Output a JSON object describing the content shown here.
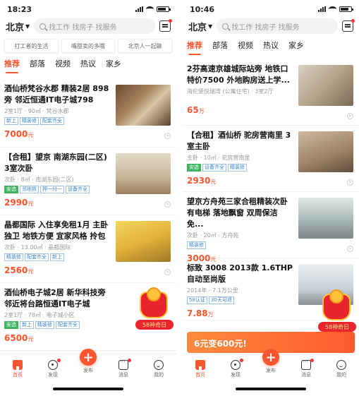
{
  "left": {
    "status": {
      "time": "18:23"
    },
    "header": {
      "city": "北京",
      "search_placeholder": "找工作 找房子 找服务"
    },
    "chips": [
      "打工者的生活",
      "嘴甜卖的多哦",
      "北京人一起聊"
    ],
    "tabs": [
      "推荐",
      "部落",
      "视频",
      "热议",
      "家乡"
    ],
    "listings": [
      {
        "title": "酒仙桥梵谷水郡 精装2居 898旁 邻近恒通IT电子城798",
        "meta": "2室1厅 · 90㎡ · 梵谷水郡",
        "tags": [
          "新上",
          "精装修",
          "配套齐全"
        ],
        "price": "7000",
        "unit": "元"
      },
      {
        "title": "【合租】望京 南湖东园(二区) 3室次卧",
        "meta": "次卧 · 8㎡ · 南湖东园(二区)",
        "tags": [
          "安选",
          "邻地铁",
          "押一付一",
          "设备齐全"
        ],
        "price": "2990",
        "unit": "元"
      },
      {
        "title": "晶都国际 入住享免租1月 主卧独卫 地铁方便 宜家风格 拎包",
        "meta": "次卧 · 13.00㎡ · 晶都国际",
        "tags": [
          "精装修",
          "配套齐全",
          "新上"
        ],
        "price": "2560",
        "unit": "元"
      },
      {
        "title": "酒仙桥电子城2居 新华科技旁 邻近将台路恒通IT电子城",
        "meta": "2室1厅 · 78㎡ · 电子城小区",
        "tags": [
          "安选",
          "新上",
          "精装修",
          "配套齐全"
        ],
        "price": "6500",
        "unit": "元"
      }
    ],
    "redpack": "58神奇日"
  },
  "right": {
    "status": {
      "time": "10:46"
    },
    "header": {
      "city": "北京",
      "search_placeholder": "找工作 找房子 找服务"
    },
    "tabs": [
      "推荐",
      "部落",
      "视频",
      "热议",
      "家乡"
    ],
    "listings": [
      {
        "title": "2芬高速京雄城际站旁 地铁口特价7500 外地购房送上学...",
        "meta": "海伦堡悦瑞湾 (公寓住宅) · 3室2厅",
        "tags": [],
        "price": "65",
        "unit": "万"
      },
      {
        "title": "【合租】酒仙桥 驼房营南里 3室主卧",
        "meta": "主卧 · 10㎡ · 驼房营南里",
        "tags": [
          "安选",
          "设备齐全",
          "精装修"
        ],
        "price": "2930",
        "unit": "元"
      },
      {
        "title": "望京方舟苑三家合租精装次卧有电梯 落地飘窗 双周保洁免...",
        "meta": "次卧 · 20㎡ · 方舟苑",
        "tags": [
          "精装修"
        ],
        "price": "3000",
        "unit": "元"
      },
      {
        "title": "标致 3008 2013款 1.6THP 自动至尚版",
        "meta": "2014年 · 7.1万公里",
        "tags": [
          "58认证",
          "30天可退"
        ],
        "price": "7.88",
        "unit": "万"
      }
    ],
    "banner": "6元变600元!",
    "redpack": "58神奇日"
  },
  "nav": {
    "home": "首页",
    "discover": "发现",
    "publish": "发布",
    "messages": "消息",
    "me": "我的"
  },
  "colors": {
    "accent": "#ff552e",
    "tag_blue": "#3a87c9",
    "tag_green": "#3cb55f"
  }
}
